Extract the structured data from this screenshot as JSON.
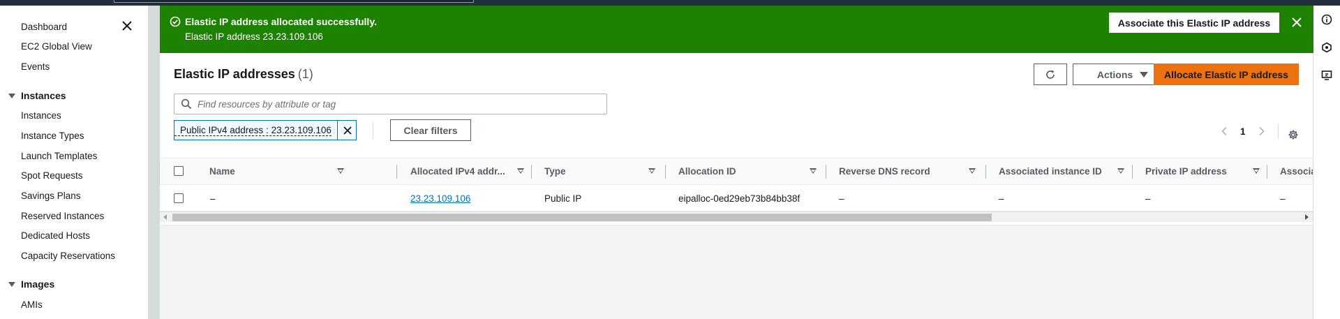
{
  "sidebar": {
    "items_top": [
      "Dashboard",
      "EC2 Global View",
      "Events"
    ],
    "section_instances": "Instances",
    "instances_items": [
      "Instances",
      "Instance Types",
      "Launch Templates",
      "Spot Requests",
      "Savings Plans",
      "Reserved Instances",
      "Dedicated Hosts",
      "Capacity Reservations"
    ],
    "section_images": "Images",
    "images_items": [
      "AMIs"
    ]
  },
  "flash": {
    "title": "Elastic IP address allocated successfully.",
    "message": "Elastic IP address 23.23.109.106",
    "action_label": "Associate this Elastic IP address"
  },
  "panel": {
    "title": "Elastic IP addresses",
    "count": "(1)",
    "actions_label": "Actions",
    "allocate_label": "Allocate Elastic IP address",
    "search_placeholder": "Find resources by attribute or tag",
    "filter_token": "Public IPv4 address : 23.23.109.106",
    "clear_filters_label": "Clear filters",
    "page_number": "1"
  },
  "table": {
    "columns": [
      "Name",
      "Allocated IPv4 addr...",
      "Type",
      "Allocation ID",
      "Reverse DNS record",
      "Associated instance ID",
      "Private IP address",
      "Associa"
    ],
    "rows": [
      {
        "name": "–",
        "ip": "23.23.109.106",
        "type": "Public IP",
        "allocation_id": "eipalloc-0ed29eb73b84bb38f",
        "reverse_dns": "–",
        "instance_id": "–",
        "private_ip": "–",
        "association": "–"
      }
    ]
  },
  "colors": {
    "success": "#1d8102",
    "primary_button": "#ec7211",
    "link": "#0073bb",
    "nav_bar": "#232f3e"
  }
}
